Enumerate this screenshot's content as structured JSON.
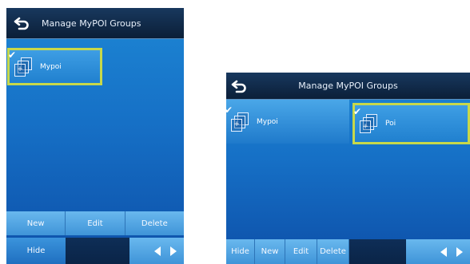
{
  "left_screen": {
    "title": "Manage MyPOI Groups",
    "items": [
      {
        "label": "Mypoi",
        "checked": true
      }
    ],
    "actions": {
      "new_label": "New",
      "edit_label": "Edit",
      "delete_label": "Delete"
    },
    "bottom": {
      "hide_label": "Hide"
    }
  },
  "right_screen": {
    "title": "Manage MyPOI Groups",
    "items": [
      {
        "label": "Mypoi",
        "checked": true
      },
      {
        "label": "Poi",
        "checked": true
      }
    ],
    "actions": {
      "hide_label": "Hide",
      "new_label": "New",
      "edit_label": "Edit",
      "delete_label": "Delete"
    }
  },
  "icons": {
    "back": "back-arrow-icon",
    "group": "group-folder-icon",
    "check": "check-icon",
    "prev": "arrow-left-icon",
    "next": "arrow-right-icon"
  },
  "colors": {
    "selection_border": "#c7d84a",
    "title_bar": "#0b1f38",
    "background_top": "#1d86d4",
    "background_bottom": "#0d4fa8"
  }
}
